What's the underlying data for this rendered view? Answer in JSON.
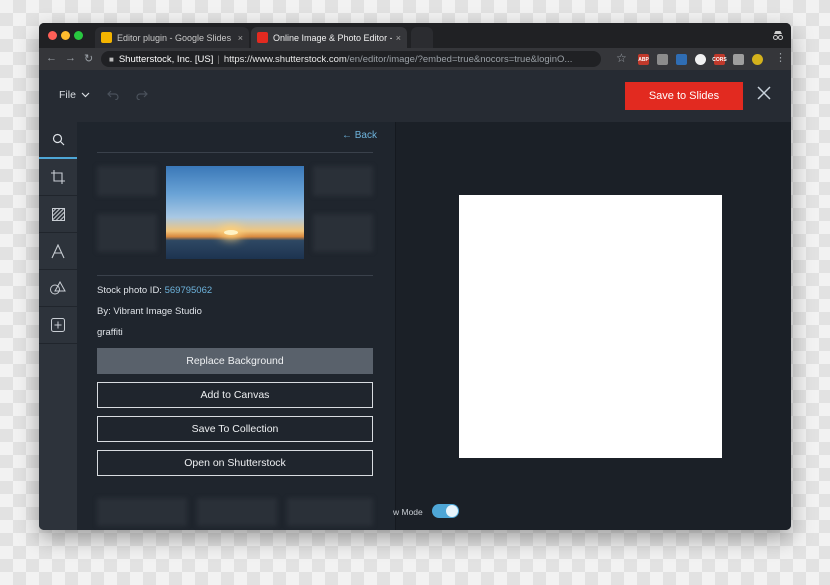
{
  "browser": {
    "tabs": [
      {
        "label": "Editor plugin - Google Slides",
        "active": false
      },
      {
        "label": "Online Image & Photo Editor -",
        "active": true
      }
    ],
    "tab_close": "×",
    "site_identity": "Shutterstock, Inc. [US]",
    "separator": "|",
    "url_host": "https://www.shutterstock.com",
    "url_path": "/en/editor/image/?embed=true&nocors=true&loginO...",
    "extensions": [
      "ABP",
      "",
      "",
      "",
      "CORS",
      "",
      ""
    ]
  },
  "app_header": {
    "file_label": "File",
    "save_label": "Save to Slides"
  },
  "sidebar": {
    "tools": [
      "search-icon",
      "crop-icon",
      "texture-icon",
      "text-icon",
      "shapes-icon",
      "add-element-icon"
    ]
  },
  "panel": {
    "back_label": "Back",
    "stock_id_prefix": "Stock photo ID:",
    "stock_id": "569795062",
    "author": "By: Vibrant Image Studio",
    "keyword": "graffiti",
    "buttons": {
      "replace": "Replace Background",
      "add": "Add to Canvas",
      "save_collection": "Save To Collection",
      "open": "Open on Shutterstock"
    }
  },
  "stage": {
    "mode_label": "w Mode",
    "mode_on": true
  },
  "colors": {
    "accent": "#4ea6d6",
    "save_button": "#e22a20",
    "app_background": "#1f252d"
  }
}
